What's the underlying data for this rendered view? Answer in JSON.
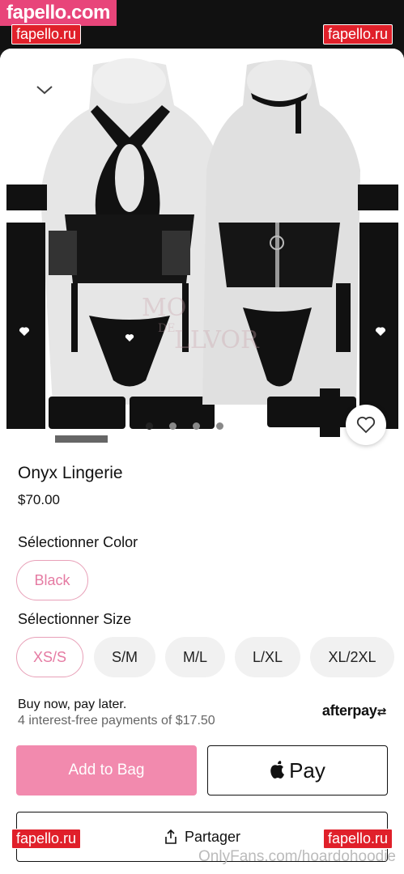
{
  "watermarks": {
    "top_left_large": "fapello.com",
    "badge_label": "fapello.ru",
    "onlyfans": "OnlyFans.com/hoardohoodie"
  },
  "product": {
    "title": "Onyx Lingerie",
    "price": "$70.00",
    "image_watermark": [
      "MO",
      "DE",
      "LLVOR"
    ]
  },
  "gallery": {
    "dots": 4,
    "active_dot": 0
  },
  "color": {
    "label": "Sélectionner Color",
    "options": [
      "Black"
    ],
    "selected": "Black"
  },
  "size": {
    "label": "Sélectionner Size",
    "options": [
      "XS/S",
      "S/M",
      "M/L",
      "L/XL",
      "XL/2XL"
    ],
    "selected": "XS/S"
  },
  "bnpl": {
    "line1": "Buy now, pay later.",
    "line2": "4 interest-free payments of $17.50",
    "brand": "afterpay"
  },
  "actions": {
    "add_to_bag": "Add to Bag",
    "pay": "Pay",
    "share": "Partager"
  },
  "colors": {
    "accent_pink": "#f28aae",
    "selected_text": "#e57aa2",
    "watermark_pink": "#e8457a",
    "badge_red": "#e0202a"
  },
  "icons": [
    "chevron-down-icon",
    "heart-icon",
    "apple-icon",
    "share-icon",
    "afterpay-logo-icon"
  ]
}
